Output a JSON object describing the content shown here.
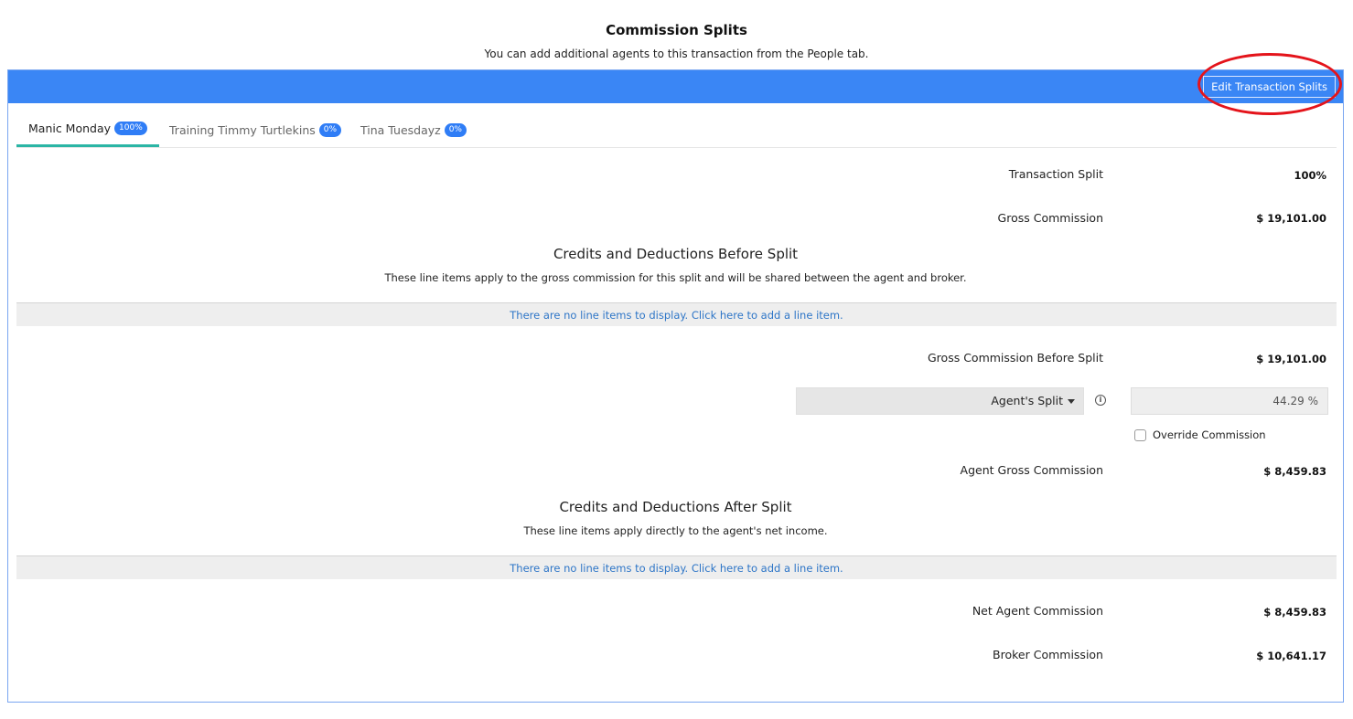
{
  "page": {
    "title": "Commission Splits",
    "subtitle": "You can add additional agents to this transaction from the People tab."
  },
  "header": {
    "edit_button_label": "Edit Transaction Splits",
    "accent_color": "#3a86f5",
    "highlight_color": "#e4141b"
  },
  "tabs": [
    {
      "label": "Manic Monday",
      "badge": "100%",
      "active": true
    },
    {
      "label": "Training Timmy Turtlekins",
      "badge": "0%",
      "active": false
    },
    {
      "label": "Tina Tuesdayz",
      "badge": "0%",
      "active": false
    }
  ],
  "summary": {
    "transaction_split_label": "Transaction Split",
    "transaction_split_value": "100%",
    "gross_commission_label": "Gross Commission",
    "gross_commission_value": "$ 19,101.00"
  },
  "before_split": {
    "title": "Credits and Deductions Before Split",
    "description": "These line items apply to the gross commission for this split and will be shared between the agent and broker.",
    "empty_message": "There are no line items to display. Click here to add a line item."
  },
  "split": {
    "gross_before_split_label": "Gross Commission Before Split",
    "gross_before_split_value": "$ 19,101.00",
    "split_type_selected": "Agent's Split",
    "split_percent_value": "44.29 %",
    "override_label": "Override Commission",
    "override_checked": false,
    "info_icon": "info-icon",
    "agent_gross_label": "Agent Gross Commission",
    "agent_gross_value": "$ 8,459.83"
  },
  "after_split": {
    "title": "Credits and Deductions After Split",
    "description": "These line items apply directly to the agent's net income.",
    "empty_message": "There are no line items to display. Click here to add a line item."
  },
  "totals": {
    "net_agent_label": "Net Agent Commission",
    "net_agent_value": "$ 8,459.83",
    "broker_label": "Broker Commission",
    "broker_value": "$ 10,641.17"
  }
}
